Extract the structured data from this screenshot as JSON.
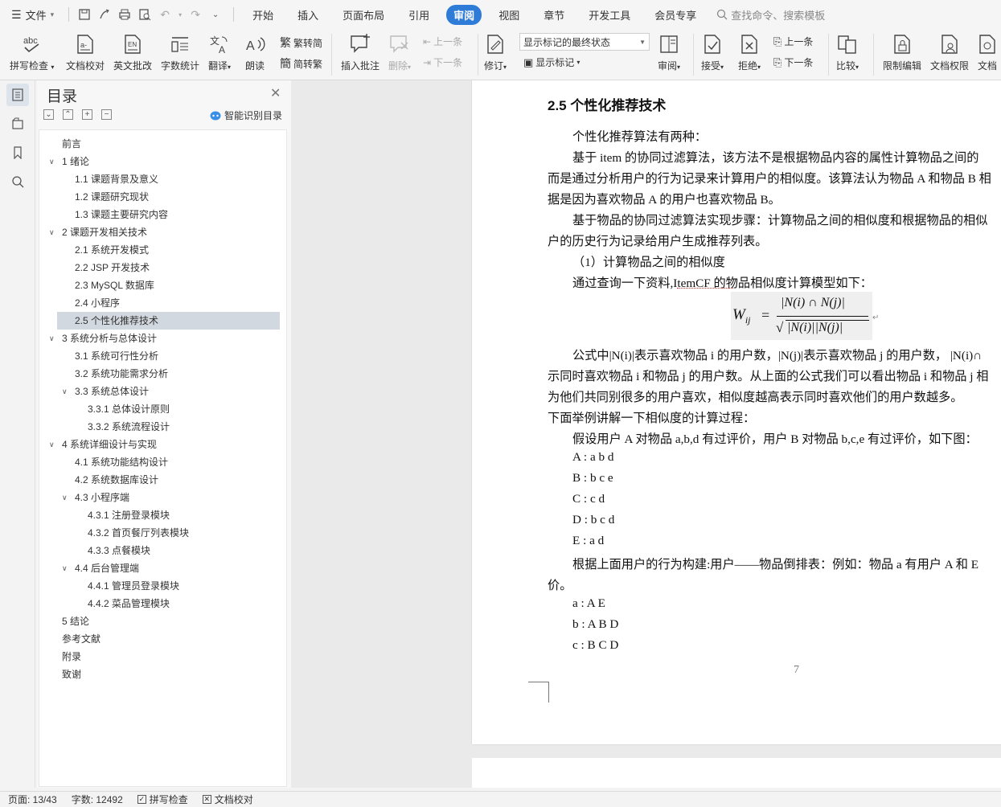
{
  "menu": {
    "file": "文件",
    "tabs": [
      "开始",
      "插入",
      "页面布局",
      "引用",
      "审阅",
      "视图",
      "章节",
      "开发工具",
      "会员专享"
    ],
    "active_tab": "审阅",
    "search_placeholder": "查找命令、搜索模板"
  },
  "ribbon": {
    "spell_check": "拼写检查",
    "doc_proof": "文档校对",
    "en_proof": "英文批改",
    "word_count": "字数统计",
    "translate": "翻译",
    "read_aloud": "朗读",
    "trad_to_simp": "繁转简",
    "simp_to_trad": "简转繁",
    "insert_comment": "插入批注",
    "delete": "删除",
    "prev": "上一条",
    "next": "下一条",
    "track_changes": "修订",
    "markup_select": "显示标记的最终状态",
    "show_markup": "显示标记",
    "review": "审阅",
    "accept": "接受",
    "reject": "拒绝",
    "prev2": "上一条",
    "next2": "下一条",
    "compare": "比较",
    "restrict_edit": "限制编辑",
    "doc_permission": "文档权限",
    "doc_more": "文档"
  },
  "toc": {
    "title": "目录",
    "ai_label": "智能识别目录",
    "items": [
      {
        "label": "前言",
        "level": 0,
        "chevron": false
      },
      {
        "label": "1 绪论",
        "level": 0,
        "chevron": true
      },
      {
        "label": "1.1 课题背景及意义",
        "level": 1,
        "chevron": false
      },
      {
        "label": "1.2 课题研究现状",
        "level": 1,
        "chevron": false
      },
      {
        "label": "1.3 课题主要研究内容",
        "level": 1,
        "chevron": false
      },
      {
        "label": "2 课题开发相关技术",
        "level": 0,
        "chevron": true
      },
      {
        "label": "2.1 系统开发模式",
        "level": 1,
        "chevron": false
      },
      {
        "label": "2.2 JSP 开发技术",
        "level": 1,
        "chevron": false
      },
      {
        "label": "2.3 MySQL 数据库",
        "level": 1,
        "chevron": false
      },
      {
        "label": "2.4  小程序",
        "level": 1,
        "chevron": false
      },
      {
        "label": "2.5  个性化推荐技术",
        "level": 1,
        "chevron": false,
        "selected": true
      },
      {
        "label": "3 系统分析与总体设计",
        "level": 0,
        "chevron": true
      },
      {
        "label": "3.1 系统可行性分析",
        "level": 1,
        "chevron": false
      },
      {
        "label": "3.2 系统功能需求分析",
        "level": 1,
        "chevron": false
      },
      {
        "label": "3.3 系统总体设计",
        "level": 1,
        "chevron": true
      },
      {
        "label": "3.3.1 总体设计原则",
        "level": 2,
        "chevron": false
      },
      {
        "label": "3.3.2 系统流程设计",
        "level": 2,
        "chevron": false
      },
      {
        "label": "4 系统详细设计与实现",
        "level": 0,
        "chevron": true
      },
      {
        "label": "4.1 系统功能结构设计",
        "level": 1,
        "chevron": false
      },
      {
        "label": "4.2 系统数据库设计",
        "level": 1,
        "chevron": false
      },
      {
        "label": "4.3 小程序端",
        "level": 1,
        "chevron": true
      },
      {
        "label": "4.3.1 注册登录模块",
        "level": 2,
        "chevron": false
      },
      {
        "label": "4.3.2 首页餐厅列表模块",
        "level": 2,
        "chevron": false
      },
      {
        "label": "4.3.3 点餐模块",
        "level": 2,
        "chevron": false
      },
      {
        "label": "4.4 后台管理端",
        "level": 1,
        "chevron": true
      },
      {
        "label": "4.4.1 管理员登录模块",
        "level": 2,
        "chevron": false
      },
      {
        "label": "4.4.2 菜品管理模块",
        "level": 2,
        "chevron": false
      },
      {
        "label": "5 结论",
        "level": 0,
        "chevron": false
      },
      {
        "label": "参考文献",
        "level": 0,
        "chevron": false
      },
      {
        "label": "附录",
        "level": 0,
        "chevron": false
      },
      {
        "label": "致谢",
        "level": 0,
        "chevron": false
      }
    ]
  },
  "document": {
    "heading": "2.5  个性化推荐技术",
    "lines": [
      "个性化推荐算法有两种：",
      "基于 item 的协同过滤算法，该方法不是根据物品内容的属性计算物品之间的",
      "而是通过分析用户的行为记录来计算用户的相似度。该算法认为物品 A 和物品 B 相",
      "据是因为喜欢物品 A 的用户也喜欢物品 B。",
      "基于物品的协同过滤算法实现步骤：计算物品之间的相似度和根据物品的相似",
      "户的历史行为记录给用户生成推荐列表。",
      "（1）计算物品之间的相似度",
      "通过查询一下资料,ItemCF 的物品相似度计算模型如下：",
      "公式中|N(i)|表示喜欢物品 i 的用户数，|N(j)|表示喜欢物品 j 的用户数，  |N(i)∩",
      "示同时喜欢物品 i 和物品 j 的用户数。从上面的公式我们可以看出物品 i 和物品 j 相",
      "为他们共同别很多的用户喜欢，相似度越高表示同时喜欢他们的用户数越多。",
      "下面举例讲解一下相似度的计算过程：",
      "假设用户 A 对物品 a,b,d 有过评价，用户 B 对物品 b,c,e 有过评价，如下图：",
      "A : a b d",
      "B : b c e",
      "C : c d",
      "D : b c d",
      "E : a d",
      "根据上面用户的行为构建:用户——物品倒排表：例如：物品 a 有用户 A 和 E",
      "价。",
      "a : A E",
      "b : A B D",
      "c : B C D"
    ],
    "formula": {
      "lhs": "W",
      "lhs_sub": "ij",
      "eq": "=",
      "numerator": "|N(i) ∩ N(j)|",
      "denominator": "|N(i)||N(j)|"
    },
    "page_number": "7"
  },
  "status": {
    "page": "页面: 13/43",
    "word_count": "字数: 12492",
    "spell_check": "拼写检查",
    "doc_proof": "文档校对"
  },
  "colors": {
    "accent": "#2f7bd8",
    "toc_selected": "#d2d8df"
  }
}
